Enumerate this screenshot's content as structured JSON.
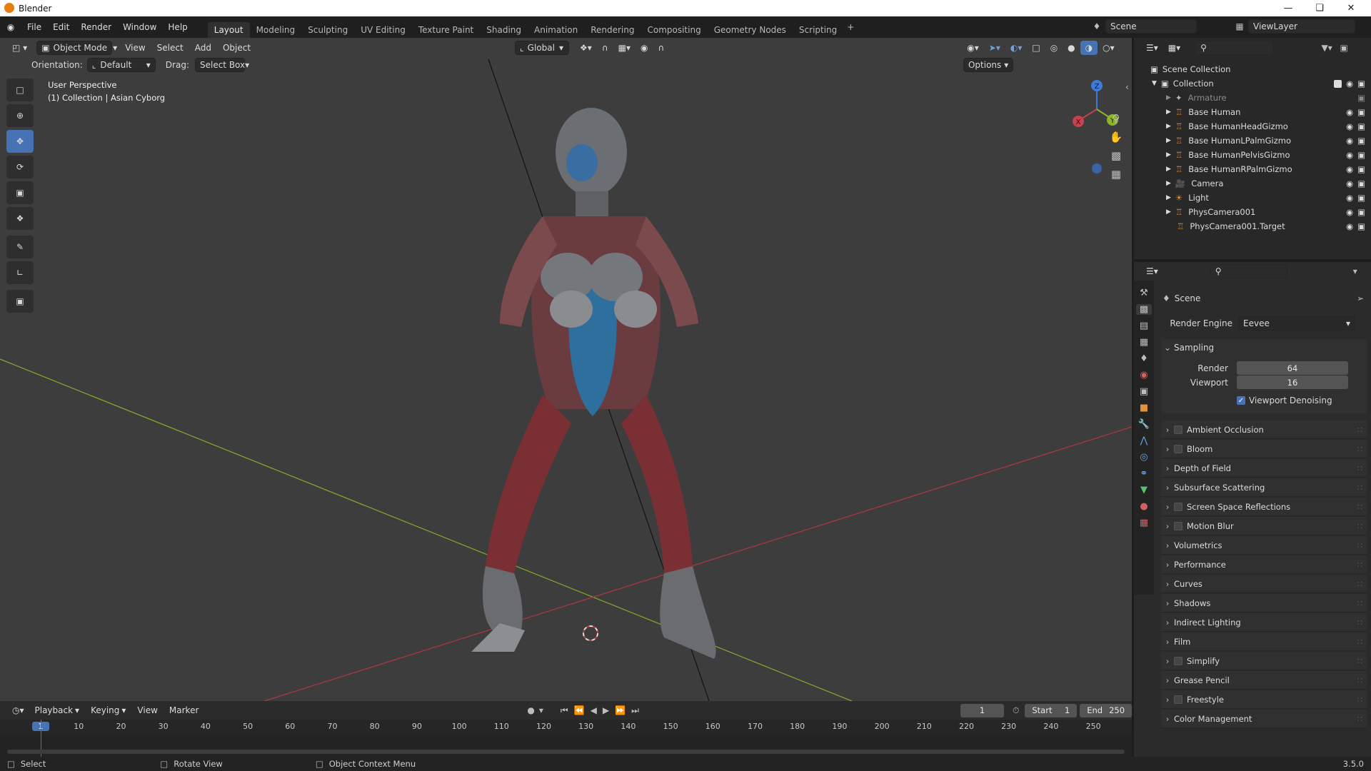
{
  "app": {
    "title": "Blender",
    "version": "3.5.0"
  },
  "menu": [
    "File",
    "Edit",
    "Render",
    "Window",
    "Help"
  ],
  "workspaces": [
    {
      "label": "Layout",
      "active": true
    },
    {
      "label": "Modeling"
    },
    {
      "label": "Sculpting"
    },
    {
      "label": "UV Editing"
    },
    {
      "label": "Texture Paint"
    },
    {
      "label": "Shading"
    },
    {
      "label": "Animation"
    },
    {
      "label": "Rendering"
    },
    {
      "label": "Compositing"
    },
    {
      "label": "Geometry Nodes"
    },
    {
      "label": "Scripting"
    }
  ],
  "scene_selector": "Scene",
  "view_layer": "ViewLayer",
  "viewport": {
    "mode": "Object Mode",
    "menus": [
      "View",
      "Select",
      "Add",
      "Object"
    ],
    "orientation_label": "Orientation:",
    "orientation": "Default",
    "drag_label": "Drag:",
    "drag": "Select Box",
    "transform_orientation": "Global",
    "options": "Options",
    "info_line1": "User Perspective",
    "info_line2": "(1) Collection | Asian Cyborg",
    "gizmo": {
      "x": "X",
      "y": "Y",
      "z": "Z"
    }
  },
  "outliner": {
    "root": "Scene Collection",
    "collection": "Collection",
    "items": [
      "Armature",
      "Base Human",
      "Base HumanHeadGizmo",
      "Base HumanLPalmGizmo",
      "Base HumanPelvisGizmo",
      "Base HumanRPalmGizmo",
      "Camera",
      "Light",
      "PhysCamera001",
      "PhysCamera001.Target"
    ]
  },
  "properties": {
    "scene_label": "Scene",
    "render_engine_label": "Render Engine",
    "render_engine": "Eevee",
    "sampling": "Sampling",
    "render_label": "Render",
    "render_value": "64",
    "viewport_label": "Viewport",
    "viewport_value": "16",
    "viewport_denoising": "Viewport Denoising",
    "panels": [
      {
        "label": "Ambient Occlusion",
        "check": true
      },
      {
        "label": "Bloom",
        "check": true
      },
      {
        "label": "Depth of Field",
        "check": false
      },
      {
        "label": "Subsurface Scattering",
        "check": false
      },
      {
        "label": "Screen Space Reflections",
        "check": true
      },
      {
        "label": "Motion Blur",
        "check": true
      },
      {
        "label": "Volumetrics",
        "check": false
      },
      {
        "label": "Performance",
        "check": false
      },
      {
        "label": "Curves",
        "check": false
      },
      {
        "label": "Shadows",
        "check": false
      },
      {
        "label": "Indirect Lighting",
        "check": false
      },
      {
        "label": "Film",
        "check": false
      },
      {
        "label": "Simplify",
        "check": true
      },
      {
        "label": "Grease Pencil",
        "check": false
      },
      {
        "label": "Freestyle",
        "check": true
      },
      {
        "label": "Color Management",
        "check": false
      }
    ]
  },
  "timeline": {
    "menus": [
      "Playback",
      "Keying",
      "View",
      "Marker"
    ],
    "current_frame": "1",
    "start_label": "Start",
    "start": "1",
    "end_label": "End",
    "end": "250",
    "ticks": [
      "1",
      "10",
      "20",
      "30",
      "40",
      "50",
      "60",
      "70",
      "80",
      "90",
      "100",
      "110",
      "120",
      "130",
      "140",
      "150",
      "160",
      "170",
      "180",
      "190",
      "200",
      "210",
      "220",
      "230",
      "240",
      "250"
    ]
  },
  "status": {
    "select": "Select",
    "rotate": "Rotate View",
    "context": "Object Context Menu"
  },
  "colors": {
    "accent": "#4772b3",
    "x_axis": "#c8414e",
    "y_axis": "#8bb62b",
    "z_axis": "#3d7bd6"
  }
}
